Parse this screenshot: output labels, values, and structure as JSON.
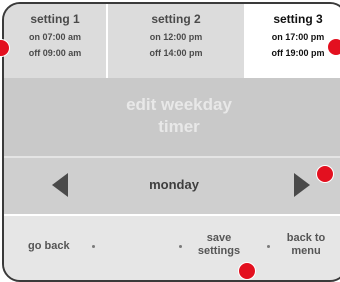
{
  "settings": [
    {
      "title": "setting 1",
      "on": "on 07:00 am",
      "off": "off 09:00 am"
    },
    {
      "title": "setting 2",
      "on": "on 12:00 pm",
      "off": "off 14:00 pm"
    },
    {
      "title": "setting 3",
      "on": "on 17:00 pm",
      "off": "off 19:00 pm"
    }
  ],
  "screen": {
    "title_line1": "edit weekday",
    "title_line2": "timer"
  },
  "day_selector": {
    "current_day": "monday",
    "prev_icon": "triangle-left-icon",
    "next_icon": "triangle-right-icon"
  },
  "bottom": {
    "go_back": "go back",
    "save_line1": "save",
    "save_line2": "settings",
    "menu_line1": "back to",
    "menu_line2": "menu"
  },
  "colors": {
    "marker": "#e3101f",
    "selected_card": "#ffffff",
    "panel": "#c9c9c9"
  }
}
